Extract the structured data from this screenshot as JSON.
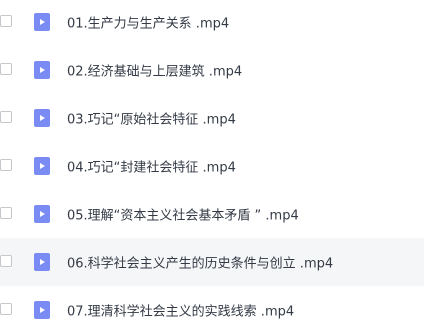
{
  "files": [
    {
      "name": "01.生产力与生产关系 .mp4"
    },
    {
      "name": "02.经济基础与上层建筑 .mp4"
    },
    {
      "name": "03.巧记“原始社会特征 .mp4"
    },
    {
      "name": "04.巧记“封建社会特征 .mp4"
    },
    {
      "name": "05.理解“资本主义社会基本矛盾 ” .mp4"
    },
    {
      "name": "06.科学社会主义产生的历史条件与创立 .mp4"
    },
    {
      "name": "07.理清科学社会主义的实践线索 .mp4"
    }
  ],
  "icons": {
    "file_type": "video-file-icon",
    "file_icon_color": "#7a8cf3",
    "row_hover_color": "#f5f6f8"
  }
}
